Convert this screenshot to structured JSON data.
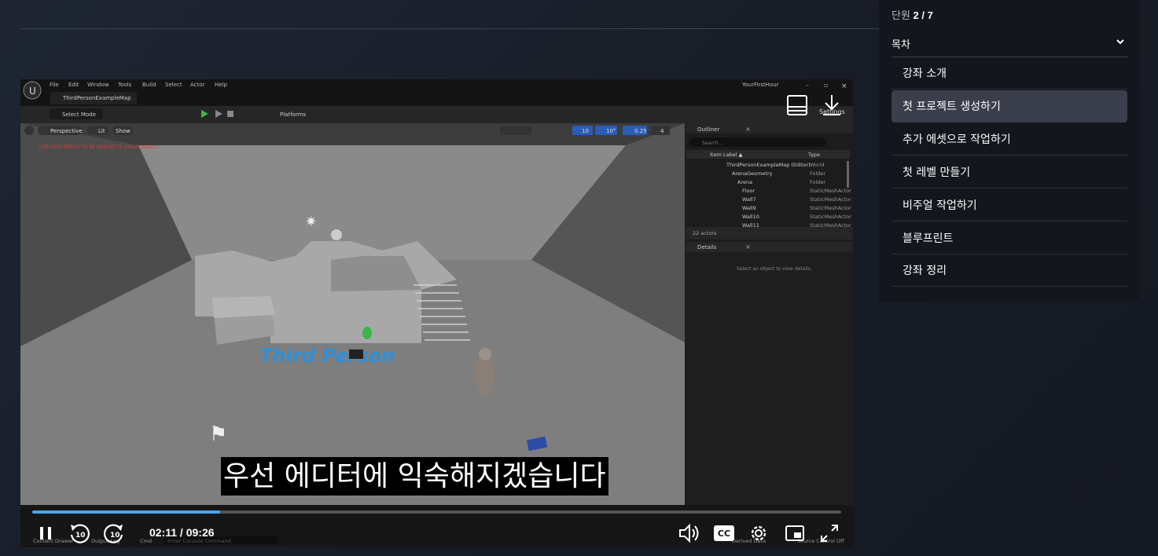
{
  "sidebar": {
    "unit_label": "단원",
    "unit_value": "2 / 7",
    "toc_title": "목차",
    "lessons": [
      "강좌 소개",
      "첫 프로젝트 생성하기",
      "추가 에셋으로 작업하기",
      "첫 레벨 만들기",
      "비주얼 작업하기",
      "블루프린트",
      "강좌 정리"
    ],
    "active_index": 1
  },
  "player": {
    "subtitle": "우선 에디터에 익숙해지겠습니다",
    "time": "02:11 / 09:26",
    "progress": 0.232,
    "skip_back": "10",
    "skip_forward": "10",
    "cc": "CC",
    "settings_overlay": "Settings"
  },
  "editor": {
    "menus": [
      "File",
      "Edit",
      "Window",
      "Tools",
      "Build",
      "Select",
      "Actor",
      "Help"
    ],
    "project": "YourFirstHour",
    "tab": "ThirdPersonExampleMap",
    "select_mode": "Select Mode",
    "platforms": "Platforms",
    "viewport_btns": [
      "Perspective",
      "Lit",
      "Show"
    ],
    "viewport_values": [
      "10",
      "10°",
      "0.25",
      "4"
    ],
    "warning": "LIGHTING NEEDS TO BE REBUILT (1 unbuilt object)",
    "scene_text": "Third Person",
    "outliner": {
      "title": "Outliner",
      "search": "Search...",
      "col_label": "Item Label ▲",
      "col_type": "Type",
      "rows": [
        {
          "label": "ThirdPersonExampleMap (Editor)",
          "type": "World"
        },
        {
          "label": "ArenaGeometry",
          "type": "Folder"
        },
        {
          "label": "Arena",
          "type": "Folder"
        },
        {
          "label": "Floor",
          "type": "StaticMeshActor"
        },
        {
          "label": "Wall7",
          "type": "StaticMeshActor"
        },
        {
          "label": "Wall9",
          "type": "StaticMeshActor"
        },
        {
          "label": "Wall10",
          "type": "StaticMeshActor"
        },
        {
          "label": "Wall11",
          "type": "StaticMeshActor"
        }
      ],
      "count": "22 actors"
    },
    "details": {
      "title": "Details",
      "hint": "Select an object to view details."
    },
    "statusbar": [
      "Content Drawer",
      "Output Log",
      "Cmd",
      "Enter Console Command",
      "Derived Data",
      "Source Control Off"
    ]
  },
  "colors": {
    "accent": "#4aa3e8",
    "sidebar_bg": "#13161d",
    "active_lesson": "#3b3f4b"
  }
}
